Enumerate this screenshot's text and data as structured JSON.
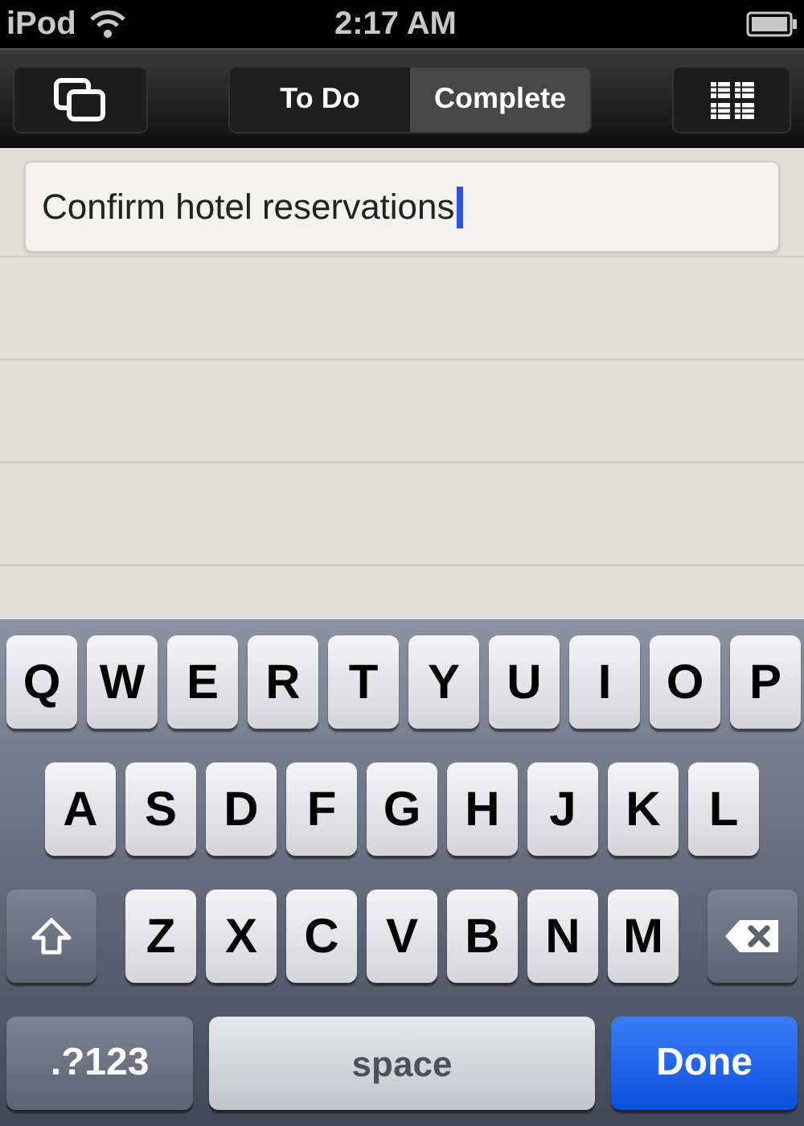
{
  "status_bar": {
    "carrier": "iPod",
    "time": "2:17 AM"
  },
  "tabs": [
    {
      "label": "To Do",
      "selected": false
    },
    {
      "label": "Complete",
      "selected": true
    }
  ],
  "task_field": {
    "value": "Confirm hotel reservations"
  },
  "keyboard": {
    "letter_rows": [
      {
        "keys": [
          "Q",
          "W",
          "E",
          "R",
          "T",
          "Y",
          "U",
          "I",
          "O",
          "P"
        ]
      },
      {
        "keys": [
          "A",
          "S",
          "D",
          "F",
          "G",
          "H",
          "J",
          "K",
          "L"
        ]
      },
      {
        "keys": [
          "Z",
          "X",
          "C",
          "V",
          "B",
          "N",
          "M"
        ]
      }
    ],
    "bottom_keys": [
      {
        "kind": "mode",
        "label": ".?123"
      },
      {
        "kind": "space",
        "label": "space"
      },
      {
        "kind": "done",
        "label": "Done"
      }
    ]
  }
}
